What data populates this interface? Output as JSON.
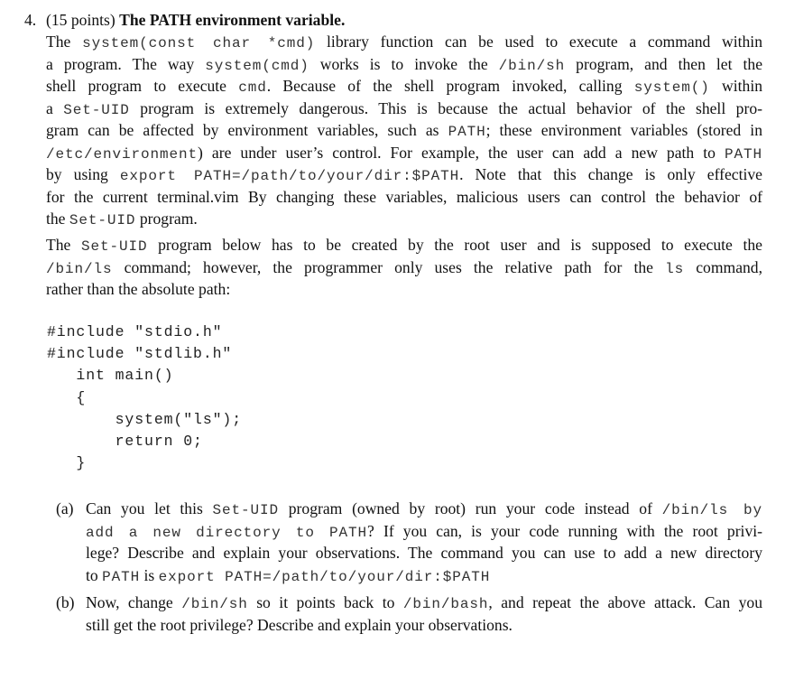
{
  "problem": {
    "number": "4.",
    "points": "(15 points)",
    "title": "The PATH environment variable."
  },
  "intro_paragraph": {
    "lines": [
      [
        {
          "t": "The ",
          "m": false
        },
        {
          "t": "system(const char *cmd)",
          "m": true
        },
        {
          "t": " library function can be used to execute a command within",
          "m": false
        }
      ],
      [
        {
          "t": "a program.  The way ",
          "m": false
        },
        {
          "t": "system(cmd)",
          "m": true
        },
        {
          "t": " works is to invoke the ",
          "m": false
        },
        {
          "t": "/bin/sh",
          "m": true
        },
        {
          "t": " program, and then let the",
          "m": false
        }
      ],
      [
        {
          "t": "shell program to execute ",
          "m": false
        },
        {
          "t": "cmd",
          "m": true
        },
        {
          "t": ".  Because of the shell program invoked, calling ",
          "m": false
        },
        {
          "t": "system()",
          "m": true
        },
        {
          "t": " within",
          "m": false
        }
      ],
      [
        {
          "t": "a ",
          "m": false
        },
        {
          "t": "Set-UID",
          "m": true
        },
        {
          "t": " program is extremely dangerous.  This is because the actual behavior of the shell pro-",
          "m": false
        }
      ],
      [
        {
          "t": "gram can be affected by environment variables, such as ",
          "m": false
        },
        {
          "t": "PATH",
          "m": true
        },
        {
          "t": "; these environment variables (stored in",
          "m": false
        }
      ],
      [
        {
          "t": "/etc/environment",
          "m": true
        },
        {
          "t": ") are under user’s control. For example, the user can add a new path to ",
          "m": false
        },
        {
          "t": "PATH",
          "m": true
        }
      ],
      [
        {
          "t": "by using ",
          "m": false
        },
        {
          "t": "export PATH=/path/to/your/dir:$PATH",
          "m": true
        },
        {
          "t": ". Note that this change is only effective",
          "m": false
        }
      ],
      [
        {
          "t": "for the current terminal.vim By changing these variables, malicious users can control the behavior of",
          "m": false
        }
      ],
      [
        {
          "t": "the ",
          "m": false
        },
        {
          "t": "Set-UID",
          "m": true
        },
        {
          "t": " program.",
          "m": false
        }
      ]
    ]
  },
  "program_paragraph": {
    "lines": [
      [
        {
          "t": "The ",
          "m": false
        },
        {
          "t": "Set-UID",
          "m": true
        },
        {
          "t": " program below has to be created by the root user and is supposed to execute the",
          "m": false
        }
      ],
      [
        {
          "t": "/bin/ls",
          "m": true
        },
        {
          "t": " command; however, the programmer only uses the relative path for the ",
          "m": false
        },
        {
          "t": "ls",
          "m": true
        },
        {
          "t": " command,",
          "m": false
        }
      ],
      [
        {
          "t": "rather than the absolute path:",
          "m": false
        }
      ]
    ]
  },
  "code": {
    "lines": [
      "#include \"stdio.h\"",
      "#include \"stdlib.h\"",
      "   int main()",
      "   {",
      "       system(\"ls\");",
      "       return 0;",
      "   }"
    ]
  },
  "subquestions": [
    {
      "label": "(a)",
      "lines": [
        [
          {
            "t": "Can you let this ",
            "m": false
          },
          {
            "t": "Set-UID",
            "m": true
          },
          {
            "t": " program (owned by root) run your code instead of ",
            "m": false
          },
          {
            "t": "/bin/ls by",
            "m": true
          }
        ],
        [
          {
            "t": "add a new directory to PATH",
            "m": true
          },
          {
            "t": "? If you can, is your code running with the root privi-",
            "m": false
          }
        ],
        [
          {
            "t": "lege? Describe and explain your observations. The command you can use to add a new directory",
            "m": false
          }
        ],
        [
          {
            "t": "to ",
            "m": false
          },
          {
            "t": "PATH",
            "m": true
          },
          {
            "t": " is ",
            "m": false
          },
          {
            "t": "export PATH=/path/to/your/dir:$PATH",
            "m": true
          }
        ]
      ]
    },
    {
      "label": "(b)",
      "lines": [
        [
          {
            "t": "Now, change ",
            "m": false
          },
          {
            "t": "/bin/sh",
            "m": true
          },
          {
            "t": " so it points back to ",
            "m": false
          },
          {
            "t": "/bin/bash",
            "m": true
          },
          {
            "t": ", and repeat the above attack. Can you",
            "m": false
          }
        ],
        [
          {
            "t": "still get the root privilege? Describe and explain your observations.",
            "m": false
          }
        ]
      ]
    }
  ]
}
